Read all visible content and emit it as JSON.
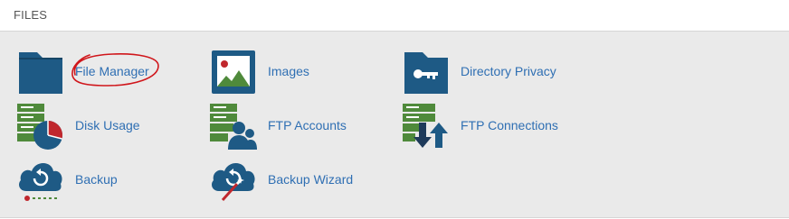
{
  "section": {
    "title": "FILES"
  },
  "items": [
    {
      "label": "File Manager",
      "icon": "folder-icon"
    },
    {
      "label": "Images",
      "icon": "image-icon"
    },
    {
      "label": "Directory Privacy",
      "icon": "folder-key-icon"
    },
    {
      "label": "Disk Usage",
      "icon": "disk-usage-icon"
    },
    {
      "label": "FTP Accounts",
      "icon": "ftp-accounts-icon"
    },
    {
      "label": "FTP Connections",
      "icon": "ftp-connections-icon"
    },
    {
      "label": "Backup",
      "icon": "backup-icon"
    },
    {
      "label": "Backup Wizard",
      "icon": "backup-wizard-icon"
    }
  ],
  "colors": {
    "icon_blue": "#1e5a85",
    "icon_green": "#4f8a3b",
    "icon_red": "#c0272d",
    "link": "#2f6fb3",
    "annotation": "#d0161b"
  }
}
